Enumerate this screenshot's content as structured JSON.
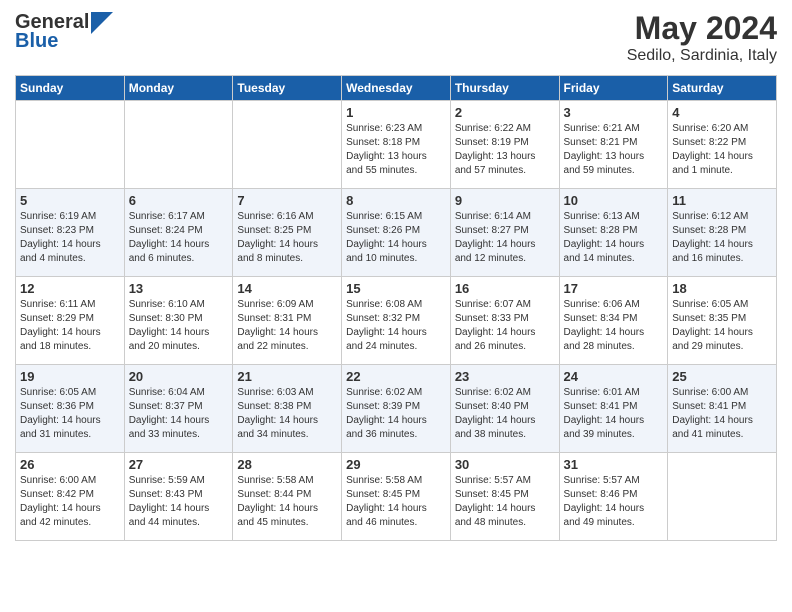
{
  "header": {
    "logo_general": "General",
    "logo_blue": "Blue",
    "title": "May 2024",
    "subtitle": "Sedilo, Sardinia, Italy"
  },
  "days_of_week": [
    "Sunday",
    "Monday",
    "Tuesday",
    "Wednesday",
    "Thursday",
    "Friday",
    "Saturday"
  ],
  "weeks": [
    [
      {
        "day": "",
        "sunrise": "",
        "sunset": "",
        "daylight": ""
      },
      {
        "day": "",
        "sunrise": "",
        "sunset": "",
        "daylight": ""
      },
      {
        "day": "",
        "sunrise": "",
        "sunset": "",
        "daylight": ""
      },
      {
        "day": "1",
        "sunrise": "Sunrise: 6:23 AM",
        "sunset": "Sunset: 8:18 PM",
        "daylight": "Daylight: 13 hours and 55 minutes."
      },
      {
        "day": "2",
        "sunrise": "Sunrise: 6:22 AM",
        "sunset": "Sunset: 8:19 PM",
        "daylight": "Daylight: 13 hours and 57 minutes."
      },
      {
        "day": "3",
        "sunrise": "Sunrise: 6:21 AM",
        "sunset": "Sunset: 8:21 PM",
        "daylight": "Daylight: 13 hours and 59 minutes."
      },
      {
        "day": "4",
        "sunrise": "Sunrise: 6:20 AM",
        "sunset": "Sunset: 8:22 PM",
        "daylight": "Daylight: 14 hours and 1 minute."
      }
    ],
    [
      {
        "day": "5",
        "sunrise": "Sunrise: 6:19 AM",
        "sunset": "Sunset: 8:23 PM",
        "daylight": "Daylight: 14 hours and 4 minutes."
      },
      {
        "day": "6",
        "sunrise": "Sunrise: 6:17 AM",
        "sunset": "Sunset: 8:24 PM",
        "daylight": "Daylight: 14 hours and 6 minutes."
      },
      {
        "day": "7",
        "sunrise": "Sunrise: 6:16 AM",
        "sunset": "Sunset: 8:25 PM",
        "daylight": "Daylight: 14 hours and 8 minutes."
      },
      {
        "day": "8",
        "sunrise": "Sunrise: 6:15 AM",
        "sunset": "Sunset: 8:26 PM",
        "daylight": "Daylight: 14 hours and 10 minutes."
      },
      {
        "day": "9",
        "sunrise": "Sunrise: 6:14 AM",
        "sunset": "Sunset: 8:27 PM",
        "daylight": "Daylight: 14 hours and 12 minutes."
      },
      {
        "day": "10",
        "sunrise": "Sunrise: 6:13 AM",
        "sunset": "Sunset: 8:28 PM",
        "daylight": "Daylight: 14 hours and 14 minutes."
      },
      {
        "day": "11",
        "sunrise": "Sunrise: 6:12 AM",
        "sunset": "Sunset: 8:28 PM",
        "daylight": "Daylight: 14 hours and 16 minutes."
      }
    ],
    [
      {
        "day": "12",
        "sunrise": "Sunrise: 6:11 AM",
        "sunset": "Sunset: 8:29 PM",
        "daylight": "Daylight: 14 hours and 18 minutes."
      },
      {
        "day": "13",
        "sunrise": "Sunrise: 6:10 AM",
        "sunset": "Sunset: 8:30 PM",
        "daylight": "Daylight: 14 hours and 20 minutes."
      },
      {
        "day": "14",
        "sunrise": "Sunrise: 6:09 AM",
        "sunset": "Sunset: 8:31 PM",
        "daylight": "Daylight: 14 hours and 22 minutes."
      },
      {
        "day": "15",
        "sunrise": "Sunrise: 6:08 AM",
        "sunset": "Sunset: 8:32 PM",
        "daylight": "Daylight: 14 hours and 24 minutes."
      },
      {
        "day": "16",
        "sunrise": "Sunrise: 6:07 AM",
        "sunset": "Sunset: 8:33 PM",
        "daylight": "Daylight: 14 hours and 26 minutes."
      },
      {
        "day": "17",
        "sunrise": "Sunrise: 6:06 AM",
        "sunset": "Sunset: 8:34 PM",
        "daylight": "Daylight: 14 hours and 28 minutes."
      },
      {
        "day": "18",
        "sunrise": "Sunrise: 6:05 AM",
        "sunset": "Sunset: 8:35 PM",
        "daylight": "Daylight: 14 hours and 29 minutes."
      }
    ],
    [
      {
        "day": "19",
        "sunrise": "Sunrise: 6:05 AM",
        "sunset": "Sunset: 8:36 PM",
        "daylight": "Daylight: 14 hours and 31 minutes."
      },
      {
        "day": "20",
        "sunrise": "Sunrise: 6:04 AM",
        "sunset": "Sunset: 8:37 PM",
        "daylight": "Daylight: 14 hours and 33 minutes."
      },
      {
        "day": "21",
        "sunrise": "Sunrise: 6:03 AM",
        "sunset": "Sunset: 8:38 PM",
        "daylight": "Daylight: 14 hours and 34 minutes."
      },
      {
        "day": "22",
        "sunrise": "Sunrise: 6:02 AM",
        "sunset": "Sunset: 8:39 PM",
        "daylight": "Daylight: 14 hours and 36 minutes."
      },
      {
        "day": "23",
        "sunrise": "Sunrise: 6:02 AM",
        "sunset": "Sunset: 8:40 PM",
        "daylight": "Daylight: 14 hours and 38 minutes."
      },
      {
        "day": "24",
        "sunrise": "Sunrise: 6:01 AM",
        "sunset": "Sunset: 8:41 PM",
        "daylight": "Daylight: 14 hours and 39 minutes."
      },
      {
        "day": "25",
        "sunrise": "Sunrise: 6:00 AM",
        "sunset": "Sunset: 8:41 PM",
        "daylight": "Daylight: 14 hours and 41 minutes."
      }
    ],
    [
      {
        "day": "26",
        "sunrise": "Sunrise: 6:00 AM",
        "sunset": "Sunset: 8:42 PM",
        "daylight": "Daylight: 14 hours and 42 minutes."
      },
      {
        "day": "27",
        "sunrise": "Sunrise: 5:59 AM",
        "sunset": "Sunset: 8:43 PM",
        "daylight": "Daylight: 14 hours and 44 minutes."
      },
      {
        "day": "28",
        "sunrise": "Sunrise: 5:58 AM",
        "sunset": "Sunset: 8:44 PM",
        "daylight": "Daylight: 14 hours and 45 minutes."
      },
      {
        "day": "29",
        "sunrise": "Sunrise: 5:58 AM",
        "sunset": "Sunset: 8:45 PM",
        "daylight": "Daylight: 14 hours and 46 minutes."
      },
      {
        "day": "30",
        "sunrise": "Sunrise: 5:57 AM",
        "sunset": "Sunset: 8:45 PM",
        "daylight": "Daylight: 14 hours and 48 minutes."
      },
      {
        "day": "31",
        "sunrise": "Sunrise: 5:57 AM",
        "sunset": "Sunset: 8:46 PM",
        "daylight": "Daylight: 14 hours and 49 minutes."
      },
      {
        "day": "",
        "sunrise": "",
        "sunset": "",
        "daylight": ""
      }
    ]
  ]
}
